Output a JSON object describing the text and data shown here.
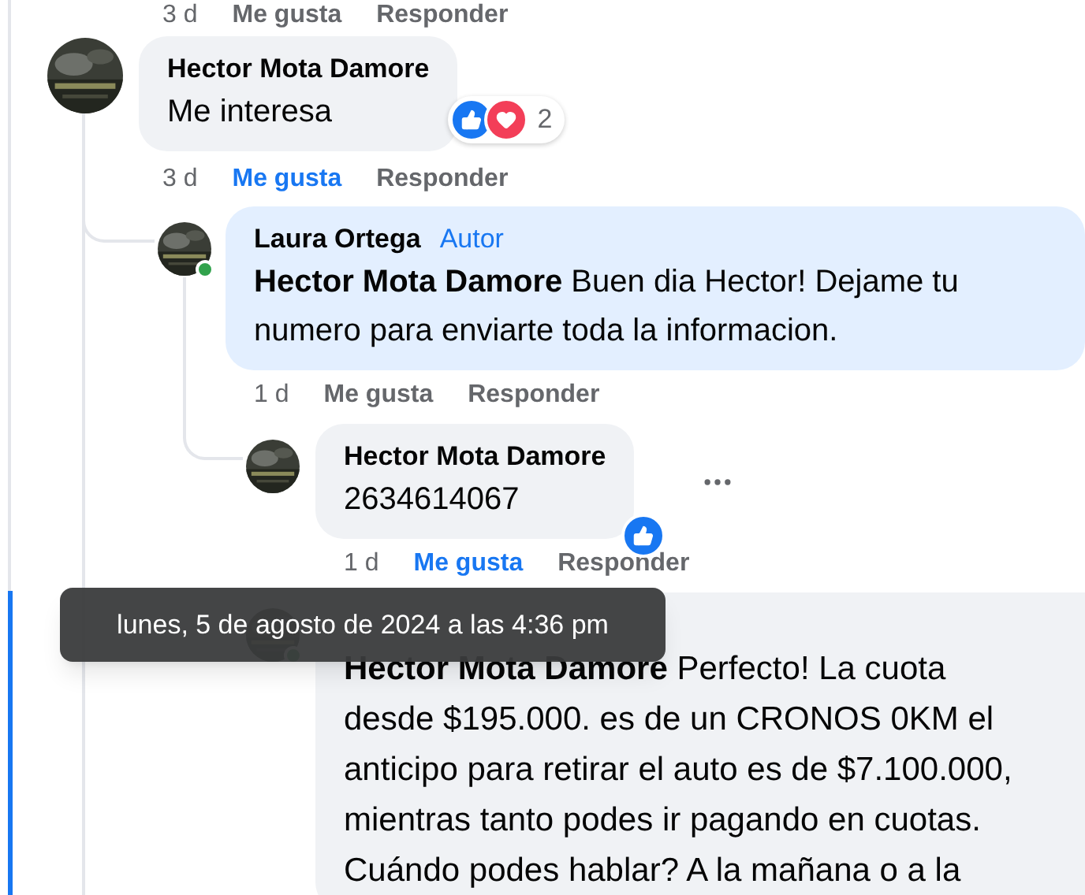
{
  "previous_actions": {
    "time": "3 d",
    "like": "Me gusta",
    "reply": "Responder",
    "liked": false
  },
  "comments": [
    {
      "author": "Hector Mota Damore",
      "text": "Me interesa",
      "reactions": [
        {
          "kind": "like"
        },
        {
          "kind": "love"
        }
      ],
      "reaction_count": "2",
      "time": "3 d",
      "like": "Me gusta",
      "liked": true,
      "reply": "Responder",
      "replies": [
        {
          "author": "Laura Ortega",
          "badge": "Autor",
          "mention": "Hector Mota Damore",
          "text": "Buen dia Hector! Dejame tu numero para enviarte toda la informacion.",
          "highlighted": true,
          "online": true,
          "time": "1 d",
          "like": "Me gusta",
          "liked": false,
          "reply": "Responder",
          "replies": [
            {
              "author": "Hector Mota Damore",
              "text": "2634614067",
              "reactions": [
                {
                  "kind": "like"
                }
              ],
              "more_menu": true,
              "time": "1 d",
              "like": "Me gusta",
              "liked": true,
              "reply": "Responder"
            },
            {
              "mention": "Hector Mota Damore",
              "text": "Perfecto! La cuota desde $195.000. es de un CRONOS 0KM el anticipo para retirar el auto es de $7.100.000, mientras tanto podes ir pagando en cuotas. Cuándo podes hablar? A la mañana o a la",
              "online": true,
              "selected": true
            }
          ]
        }
      ]
    }
  ],
  "tooltip": {
    "text": "lunes, 5 de agosto de 2024 a las 4:36 pm"
  }
}
